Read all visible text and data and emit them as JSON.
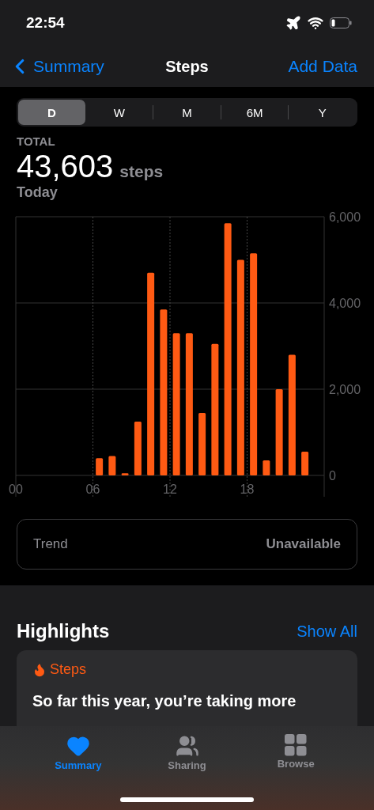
{
  "status_bar": {
    "time": "22:54"
  },
  "nav": {
    "back": "Summary",
    "title": "Steps",
    "action": "Add Data"
  },
  "ranges": [
    {
      "label": "D",
      "selected": true
    },
    {
      "label": "W",
      "selected": false
    },
    {
      "label": "M",
      "selected": false
    },
    {
      "label": "6M",
      "selected": false
    },
    {
      "label": "Y",
      "selected": false
    }
  ],
  "summary": {
    "caption": "TOTAL",
    "value": "43,603",
    "unit": "steps",
    "period": "Today"
  },
  "chart": {
    "chart_data": {
      "type": "bar",
      "x": [
        6.5,
        7.5,
        8.5,
        9.5,
        10.5,
        11.5,
        12.5,
        13.5,
        14.5,
        15.5,
        16.5,
        17.5,
        18.5,
        19.5,
        20.5,
        21.5,
        22.5
      ],
      "series": [
        {
          "color": "#ff5a13",
          "values": [
            400,
            450,
            50,
            1250,
            4700,
            3850,
            3300,
            3300,
            1450,
            3050,
            5850,
            5000,
            5150,
            350,
            2000,
            2800,
            550
          ]
        }
      ],
      "grid": true,
      "xlim": [
        0,
        24
      ],
      "ylim": [
        0,
        6000
      ],
      "xticks": [
        {
          "value": 0,
          "label": "00"
        },
        {
          "value": 6,
          "label": "06"
        },
        {
          "value": 12,
          "label": "12"
        },
        {
          "value": 18,
          "label": "18"
        }
      ],
      "yticks": [
        {
          "value": 0,
          "label": "0"
        },
        {
          "value": 2000,
          "label": "2,000"
        },
        {
          "value": 4000,
          "label": "4,000"
        },
        {
          "value": 6000,
          "label": "6,000"
        }
      ]
    }
  },
  "trend": {
    "label": "Trend",
    "value": "Unavailable"
  },
  "highlights": {
    "title": "Highlights",
    "action": "Show All",
    "card": {
      "category": "Steps",
      "text": "So far this year, you’re taking more"
    }
  },
  "tab_bar": [
    {
      "label": "Summary",
      "selected": true
    },
    {
      "label": "Sharing",
      "selected": false
    },
    {
      "label": "Browse",
      "selected": false
    }
  ]
}
